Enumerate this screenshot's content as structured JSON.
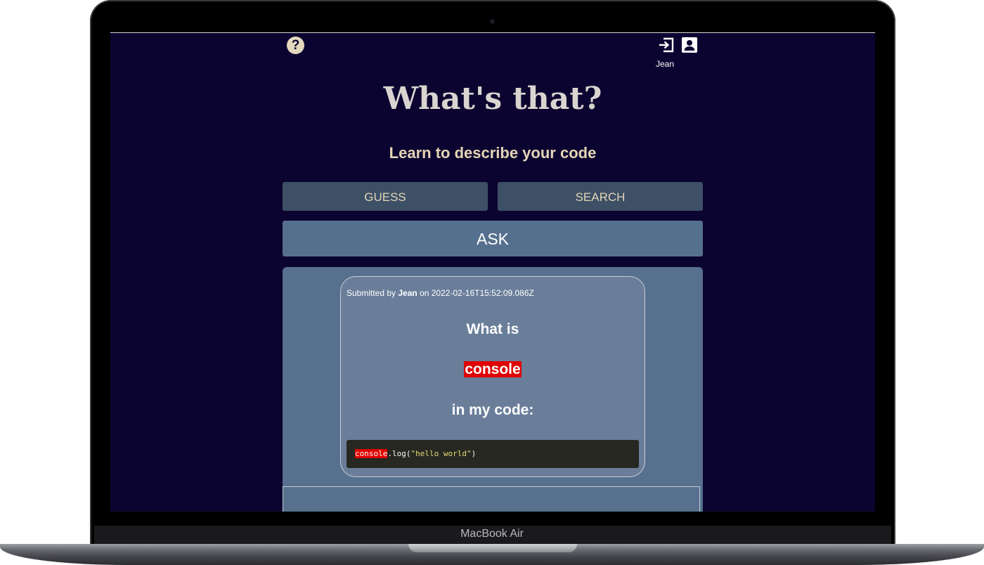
{
  "device": {
    "model_label": "MacBook Air"
  },
  "header": {
    "help_icon": "question-circle-icon",
    "login_icon": "login-icon",
    "user_icon": "user-account-icon",
    "user_name": "Jean"
  },
  "page": {
    "title": "What's that?",
    "subtitle": "Learn to describe your code"
  },
  "nav": {
    "guess_label": "GUESS",
    "search_label": "SEARCH",
    "ask_label": "ASK"
  },
  "question": {
    "submitted_prefix": "Submitted by ",
    "author": "Jean",
    "submitted_on": " on ",
    "timestamp": "2022-02-16T15:52:09.086Z",
    "line_what": "What is",
    "term": "console",
    "line_in": "in my code:",
    "code_highlight": "console",
    "code_rest_before": ".log(",
    "code_string": "\"hello world\"",
    "code_rest_after": ")"
  },
  "colors": {
    "screen_bg": "#0c0430",
    "accent_text": "#e4d5b6",
    "button_bg": "#3d5066",
    "panel_bg": "#56708e",
    "card_bg": "#6a7e9a",
    "highlight": "#e00000",
    "code_bg": "#272822"
  }
}
